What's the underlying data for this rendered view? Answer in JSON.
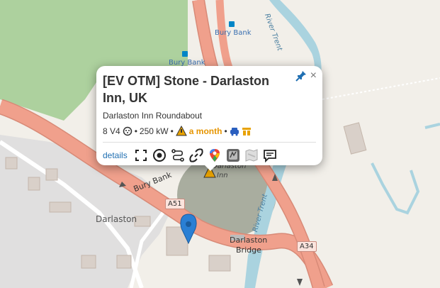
{
  "map": {
    "labels": {
      "bury_bank_top": "Bury Bank",
      "bury_bank_mid": "Bury Bank",
      "bury_bank_road": "Bury Bank",
      "river_trent_top": "River Trent",
      "river_trent_bottom": "River Trent",
      "darlaston": "Darlaston",
      "darlaston_bridge_1": "Darlaston",
      "darlaston_bridge_2": "Bridge",
      "darlaston_inn_1": "Darlaston",
      "darlaston_inn_2": "Inn"
    },
    "road_refs": {
      "a51": "A51",
      "a34": "A34"
    },
    "colors": {
      "road": "#f0a08c",
      "road_casing": "#d88a77",
      "water": "#aad3df",
      "wood": "#add19e",
      "grass": "#cfe5b8",
      "building": "#d9d0c9",
      "land": "#f2efe9",
      "residential": "#e0dfdf",
      "marker": "#2a7fd4"
    }
  },
  "popup": {
    "title": "[EV OTM] Stone - Darlaston Inn, UK",
    "subtitle": "Darlaston Inn Roundabout",
    "connectors": "8 V4",
    "power": "250 kW",
    "separator": "•",
    "age": "a month",
    "details_label": "details",
    "close_label": "×",
    "colors": {
      "age": "#e69500",
      "link": "#1f6fb2"
    }
  }
}
